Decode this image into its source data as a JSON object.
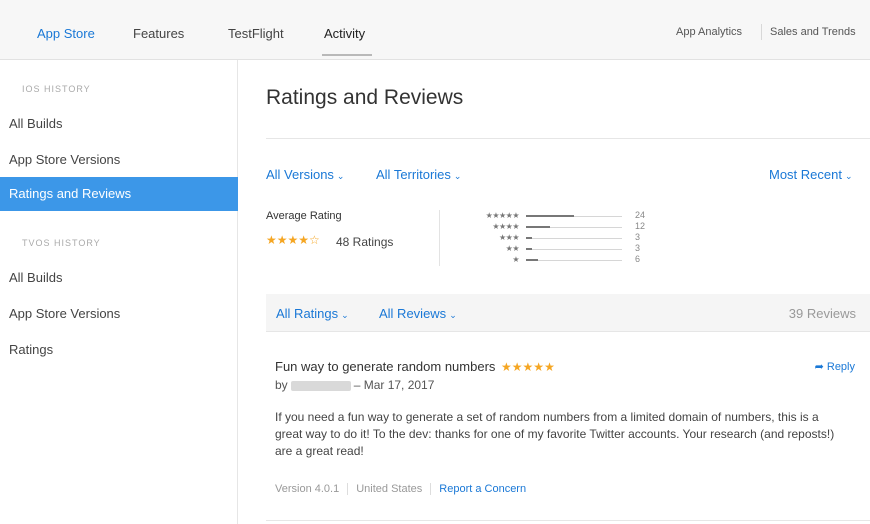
{
  "topnav": {
    "tabs": [
      "App Store",
      "Features",
      "TestFlight",
      "Activity"
    ],
    "right_links": [
      "App Analytics",
      "Sales and Trends"
    ]
  },
  "sidebar": {
    "ios_section": "iOS HISTORY",
    "ios_items": [
      "All Builds",
      "App Store Versions",
      "Ratings and Reviews"
    ],
    "tvos_section": "tvOS HISTORY",
    "tvos_items": [
      "All Builds",
      "App Store Versions",
      "Ratings"
    ]
  },
  "main": {
    "title": "Ratings and Reviews",
    "filters": {
      "versions": "All Versions",
      "territories": "All Territories",
      "sort": "Most Recent"
    },
    "average": {
      "label": "Average Rating",
      "stars": "★★★★☆",
      "count_text": "48 Ratings",
      "rating_value": 4
    },
    "distribution": [
      {
        "stars": "★★★★★",
        "count": "24",
        "fraction": 0.5
      },
      {
        "stars": "★★★★",
        "count": "12",
        "fraction": 0.25
      },
      {
        "stars": "★★★",
        "count": "3",
        "fraction": 0.0625
      },
      {
        "stars": "★★",
        "count": "3",
        "fraction": 0.0625
      },
      {
        "stars": "★",
        "count": "6",
        "fraction": 0.125
      }
    ],
    "reviews_bar": {
      "ratings_filter": "All Ratings",
      "reviews_filter": "All Reviews",
      "count_text": "39 Reviews"
    },
    "review": {
      "title": "Fun way to generate random numbers",
      "stars": "★★★★★",
      "reply": "Reply",
      "by": "by",
      "date": "– Mar 17, 2017",
      "body": "If you need a fun way to generate a set of random numbers from a limited domain of numbers, this is a great way to do it! To the dev: thanks for one of my favorite Twitter accounts. Your research (and reposts!) are a great read!",
      "version": "Version 4.0.1",
      "territory": "United States",
      "report": "Report a Concern"
    },
    "colors": {
      "accent": "#1a78d6",
      "selected": "#3c97e8",
      "star": "#f5a623"
    },
    "icons": {
      "chevron": "chevron-down-icon",
      "reply": "reply-arrow-icon"
    }
  }
}
